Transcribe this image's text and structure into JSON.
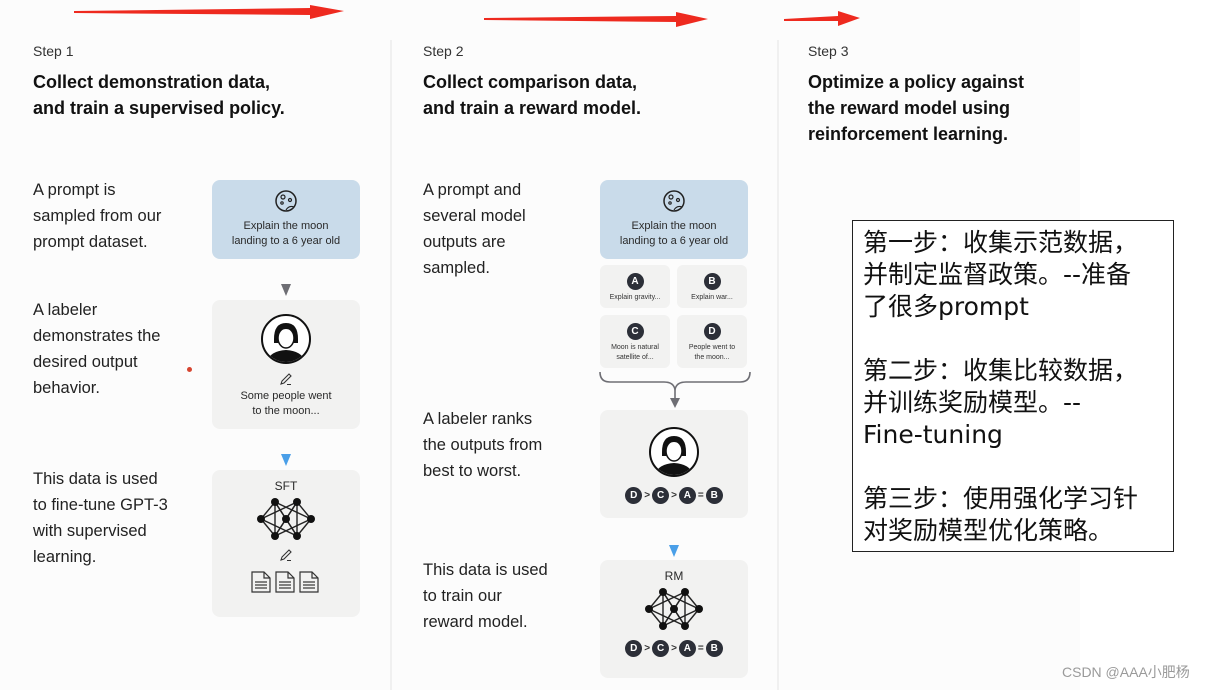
{
  "arrows": [
    {
      "name": "step1-to-step2-arrow",
      "color": "#ee2a1f"
    },
    {
      "name": "step2-to-step3-arrow",
      "color": "#ee2a1f"
    },
    {
      "name": "step3-arrow",
      "color": "#ee2a1f"
    }
  ],
  "steps": [
    {
      "label": "Step 1",
      "title_lines": [
        "Collect demonstration data,",
        "and train a supervised policy."
      ],
      "descriptions": [
        [
          "A prompt is",
          "sampled from our",
          "prompt dataset."
        ],
        [
          "A labeler",
          "demonstrates the",
          "desired output",
          "behavior."
        ],
        [
          "This data is used",
          "to fine-tune GPT-3",
          "with supervised",
          "learning."
        ]
      ],
      "prompt_card": {
        "icon": "moon-icon",
        "lines": [
          "Explain the moon",
          "landing to a 6 year old"
        ]
      },
      "labeler_card": {
        "icon": "labeler-avatar-icon",
        "pencil": "pencil-icon",
        "lines": [
          "Some people went",
          "to the moon..."
        ]
      },
      "model_card": {
        "label": "SFT",
        "icon": "neural-network-icon",
        "pencil": "pencil-icon",
        "docs": "documents-icon"
      }
    },
    {
      "label": "Step 2",
      "title_lines": [
        "Collect comparison data,",
        "and train a reward model."
      ],
      "descriptions": [
        [
          "A prompt and",
          "several model",
          "outputs are",
          "sampled."
        ],
        [
          "A labeler ranks",
          "the outputs from",
          "best to worst."
        ],
        [
          "This data is used",
          "to train our",
          "reward model."
        ]
      ],
      "prompt_card": {
        "icon": "moon-icon",
        "lines": [
          "Explain the moon",
          "landing to a 6 year old"
        ]
      },
      "outputs": [
        {
          "letter": "A",
          "lines": [
            "Explain gravity..."
          ]
        },
        {
          "letter": "B",
          "lines": [
            "Explain war..."
          ]
        },
        {
          "letter": "C",
          "lines": [
            "Moon is natural",
            "satellite of..."
          ]
        },
        {
          "letter": "D",
          "lines": [
            "People went to",
            "the moon..."
          ]
        }
      ],
      "ranking": [
        "D",
        ">",
        "C",
        ">",
        "A",
        "=",
        "B"
      ],
      "model_card": {
        "label": "RM",
        "icon": "neural-network-icon"
      }
    },
    {
      "label": "Step 3",
      "title_lines": [
        "Optimize a policy against",
        "the reward model using",
        "reinforcement learning."
      ]
    }
  ],
  "note": {
    "paragraphs": [
      "第一步：收集示范数据，\n并制定监督政策。--准备\n了很多prompt",
      "第二步：收集比较数据，\n并训练奖励模型。--\nFine-tuning",
      "第三步：使用强化学习针\n对奖励模型优化策略。"
    ]
  },
  "watermark": "CSDN @AAA小肥杨",
  "colors": {
    "prompt_card": "#c9dbea",
    "card": "#f2f2f1",
    "arrow_red": "#ee2a1f",
    "arrow_blue": "#4a9fe8",
    "arrow_gray": "#6e6e74"
  }
}
